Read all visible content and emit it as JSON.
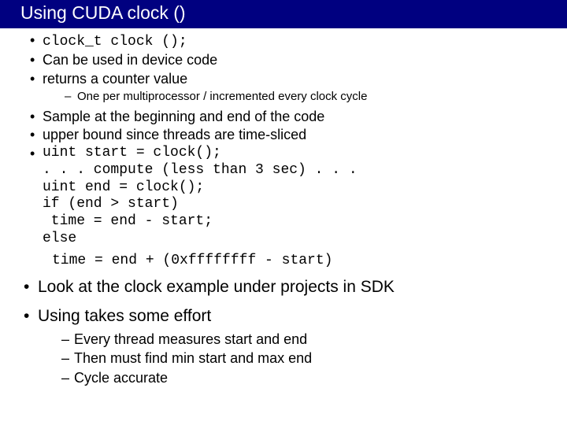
{
  "title": "Using CUDA clock ()",
  "bullets": {
    "b1": "clock_t clock ();",
    "b2": "Can be used in device code",
    "b3": "returns a counter value",
    "b3_sub1": "One per multiprocessor / incremented every clock cycle",
    "b4": "Sample at the beginning and end of the code",
    "b5": "upper bound since threads are time-sliced",
    "code": "uint start = clock();\n. . . compute (less than 3 sec) . . .\nuint end = clock();\nif (end > start)\n time = end - start;\nelse",
    "orphan": "time = end + (0xffffffff - start)"
  },
  "big": {
    "b1": "Look at the clock example under projects  in SDK",
    "b2": "Using takes some effort",
    "b2_sub1": "Every thread measures start and end",
    "b2_sub2": "Then must find min start and max end",
    "b2_sub3": "Cycle accurate"
  }
}
